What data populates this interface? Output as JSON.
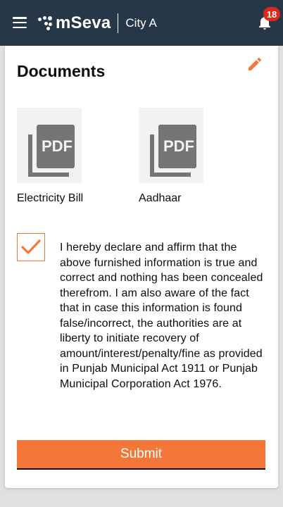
{
  "header": {
    "brand": "mSeva",
    "city": "City A",
    "notification_count": "18"
  },
  "documents": {
    "title": "Documents",
    "items": [
      {
        "label": "Electricity Bill",
        "file_type": "PDF"
      },
      {
        "label": "Aadhaar",
        "file_type": "PDF"
      }
    ]
  },
  "declaration": {
    "checked": true,
    "text": "I hereby declare and affirm that the above furnished information is true and correct and nothing has been concealed therefrom. I am also aware of the fact that in case this information is found false/incorrect, the authorities are at liberty to initiate recovery of amount/interest/penalty/fine as provided in Punjab Municipal Act 1911 or Punjab Municipal Corporation Act 1976."
  },
  "actions": {
    "submit_label": "Submit"
  },
  "colors": {
    "header_bg": "#263847",
    "accent": "#f47738",
    "badge": "#e0271a",
    "text": "#0b0c0c"
  },
  "icons": {
    "menu": "hamburger-icon",
    "notifications": "bell-icon",
    "edit": "pencil-icon",
    "document": "pdf-icon",
    "check": "checkmark-icon"
  }
}
